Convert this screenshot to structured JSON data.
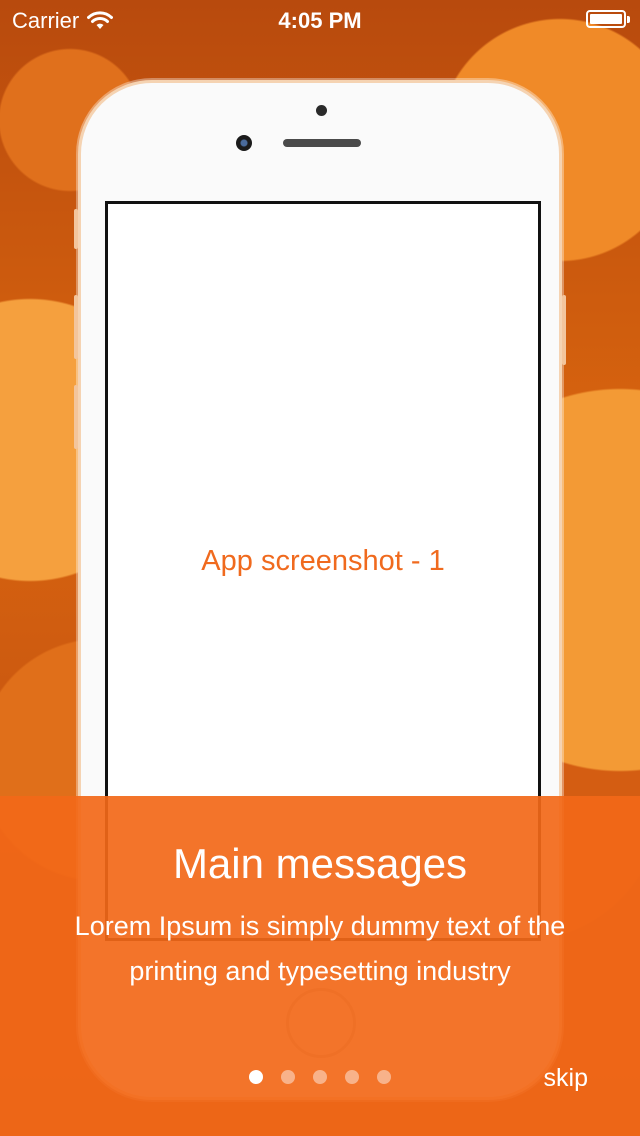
{
  "status_bar": {
    "carrier": "Carrier",
    "time": "4:05 PM",
    "wifi_icon": "wifi-icon",
    "battery_icon": "battery-icon"
  },
  "device_mockup": {
    "screenshot_label": "App screenshot - 1"
  },
  "message_panel": {
    "title": "Main messages",
    "body": "Lorem Ipsum is simply dummy text of the printing and typesetting industry",
    "page_count": 5,
    "current_page": 1,
    "skip_label": "skip"
  },
  "colors": {
    "accent": "#f26818",
    "label": "#f06a1e",
    "background_orange": "#d9650f"
  }
}
